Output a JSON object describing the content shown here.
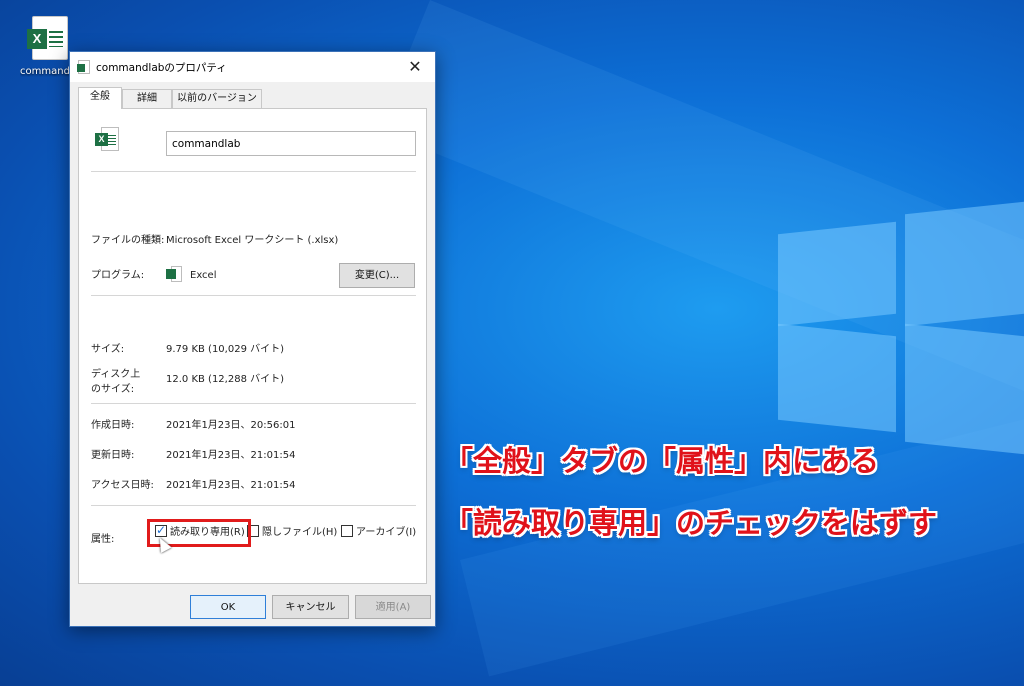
{
  "desktop": {
    "icon_label": "commandlab"
  },
  "dialog": {
    "title": "commandlabのプロパティ",
    "close_glyph": "✕",
    "tabs": [
      {
        "label": "全般"
      },
      {
        "label": "詳細"
      },
      {
        "label": "以前のバージョン"
      }
    ],
    "active_tab": "全般",
    "filename_value": "commandlab",
    "file_type_label": "ファイルの種類:",
    "file_type_value": "Microsoft Excel ワークシート (.xlsx)",
    "program_label": "プログラム:",
    "program_value": "Excel",
    "change_button": "変更(C)...",
    "size_label": "サイズ:",
    "size_value": "9.79 KB (10,029 バイト)",
    "disk_size_label_line1": "ディスク上",
    "disk_size_label_line2": "のサイズ:",
    "disk_size_value": "12.0 KB (12,288 バイト)",
    "created_label": "作成日時:",
    "created_value": "2021年1月23日、20:56:01",
    "modified_label": "更新日時:",
    "modified_value": "2021年1月23日、21:01:54",
    "accessed_label": "アクセス日時:",
    "accessed_value": "2021年1月23日、21:01:54",
    "attributes_label": "属性:",
    "attributes": [
      {
        "label": "読み取り専用(R)",
        "checked": true
      },
      {
        "label": "隠しファイル(H)",
        "checked": false
      },
      {
        "label": "アーカイブ(I)",
        "checked": false
      }
    ],
    "ok_button": "OK",
    "cancel_button": "キャンセル",
    "apply_button": "適用(A)"
  },
  "annotation": {
    "line1": "「全般」タブの「属性」内にある",
    "line2": "「読み取り専用」のチェックをはずす",
    "color": "#e0121a"
  },
  "colors": {
    "excel_green": "#1d7044",
    "highlight_red": "#e11b1b",
    "accent_blue": "#2f7fd8"
  }
}
